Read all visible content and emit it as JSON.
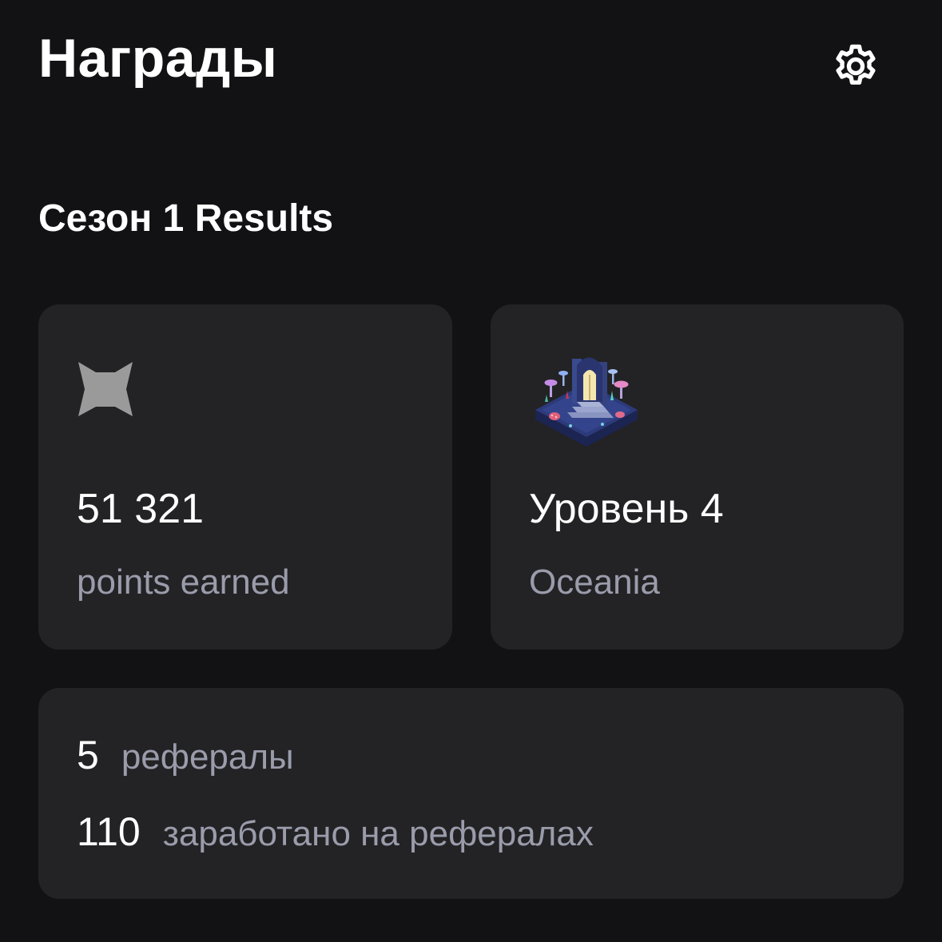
{
  "header": {
    "title": "Награды",
    "settings_icon": "gear-icon"
  },
  "season": {
    "title": "Сезон 1 Results"
  },
  "points_card": {
    "icon": "fox-logo-icon",
    "value": "51 321",
    "label": "points earned"
  },
  "level_card": {
    "image": "oceania-level-illustration",
    "value": "Уровень 4",
    "label": "Oceania"
  },
  "referrals": {
    "count": "5",
    "count_label": "рефералы",
    "earned": "110",
    "earned_label": "заработано на рефералах"
  },
  "colors": {
    "background": "#121214",
    "card": "#232325",
    "primary_text": "#ffffff",
    "secondary_text": "#9a9cab"
  }
}
